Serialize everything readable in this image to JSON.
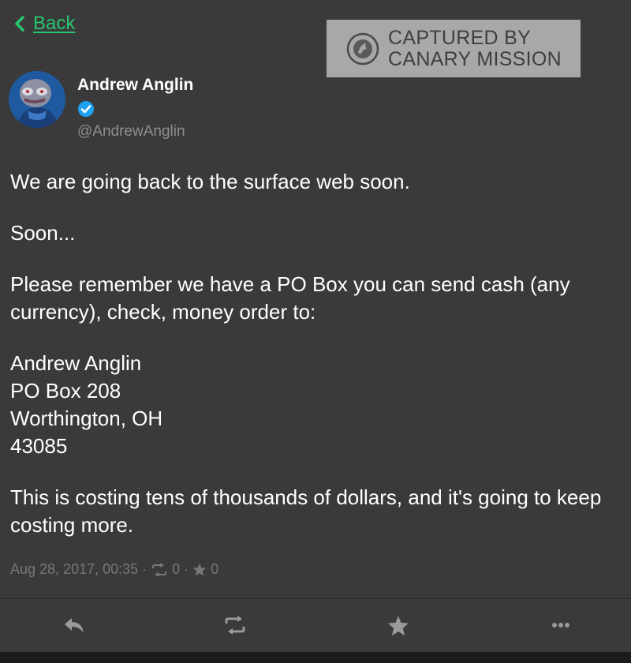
{
  "nav": {
    "back_label": "Back"
  },
  "watermark": {
    "line1": "CAPTURED BY",
    "line2": "CANARY MISSION"
  },
  "author": {
    "name": "Andrew Anglin",
    "handle": "@AndrewAnglin"
  },
  "post": {
    "p1": "We are going back to the surface web soon.",
    "p2": "Soon...",
    "p3": "Please remember we have a PO Box you can send cash (any currency), check, money order to:",
    "address": {
      "line1": "Andrew Anglin",
      "line2": "PO Box 208",
      "line3": "Worthington, OH",
      "line4": "43085"
    },
    "p4": "This is costing tens of thousands of dollars, and it's going to keep costing more."
  },
  "meta": {
    "timestamp": "Aug 28, 2017, 00:35",
    "separator": "·",
    "reposts": "0",
    "favorites": "0"
  },
  "colors": {
    "background": "#3a3a3a",
    "accent_link": "#28c76f",
    "verified": "#1da1f2",
    "muted_text": "#8e8e8e",
    "watermark_bg": "#a8a8a8"
  },
  "icons": {
    "back": "chevron-left-icon",
    "verified": "verified-badge-icon",
    "reply": "reply-icon",
    "repost": "repost-icon",
    "favorite": "star-icon",
    "more": "more-icon"
  }
}
